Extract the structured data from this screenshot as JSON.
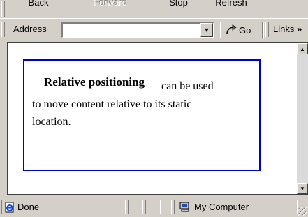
{
  "toolbar": {
    "back_label": "Back",
    "forward_label": "Forward",
    "stop_label": "Stop",
    "refresh_label": "Refresh"
  },
  "address_bar": {
    "label": "Address",
    "value": "",
    "go_label": "Go",
    "links_label": "Links",
    "links_chevron": "»"
  },
  "page": {
    "heading": "Relative positioning",
    "line1": "can be used",
    "line2": "to move content relative to its static",
    "line3": "location.",
    "box_border_color": "#0000cc"
  },
  "status_bar": {
    "status_text": "Done",
    "zone_text": "My Computer"
  },
  "icons": {
    "page": "ie-page-icon",
    "zone": "computer-icon",
    "go": "go-arrow-icon"
  }
}
